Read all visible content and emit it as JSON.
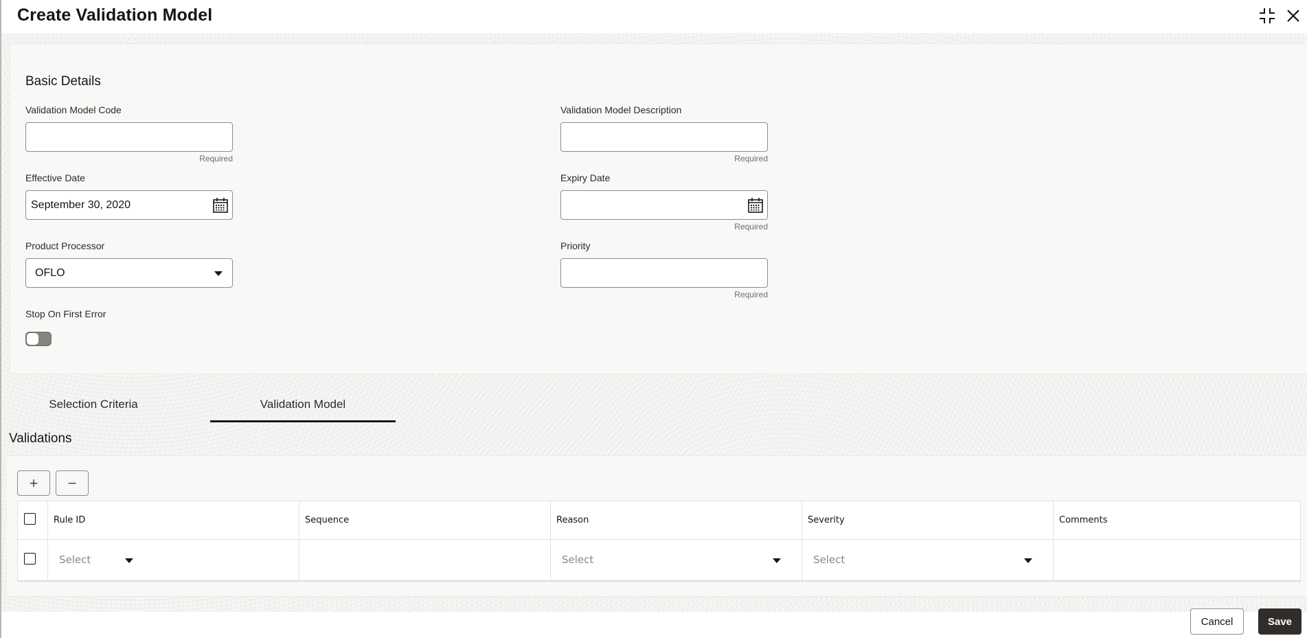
{
  "dialog": {
    "title": "Create Validation Model",
    "minimize_icon": "collapse-icon",
    "close_icon": "close-icon"
  },
  "basic_details": {
    "section_title": "Basic Details",
    "validation_model_code": {
      "label": "Validation Model Code",
      "value": "",
      "hint": "Required"
    },
    "validation_model_description": {
      "label": "Validation Model Description",
      "value": "",
      "hint": "Required"
    },
    "effective_date": {
      "label": "Effective Date",
      "value": "September 30, 2020",
      "icon": "calendar-icon"
    },
    "expiry_date": {
      "label": "Expiry Date",
      "value": "",
      "hint": "Required",
      "icon": "calendar-icon"
    },
    "product_processor": {
      "label": "Product Processor",
      "value": "OFLO"
    },
    "priority": {
      "label": "Priority",
      "value": "",
      "hint": "Required"
    },
    "stop_on_first_error": {
      "label": "Stop On First Error",
      "checked": false
    }
  },
  "tabs": [
    {
      "label": "Selection Criteria",
      "active": false
    },
    {
      "label": "Validation Model",
      "active": true
    }
  ],
  "validations": {
    "title": "Validations",
    "add_label": "+",
    "remove_label": "−",
    "columns": [
      "Rule ID",
      "Sequence",
      "Reason",
      "Severity",
      "Comments"
    ],
    "rows": [
      {
        "rule_id": "Select",
        "sequence": "",
        "reason": "Select",
        "severity": "Select",
        "comments": ""
      }
    ]
  },
  "footer": {
    "cancel_label": "Cancel",
    "save_label": "Save"
  }
}
